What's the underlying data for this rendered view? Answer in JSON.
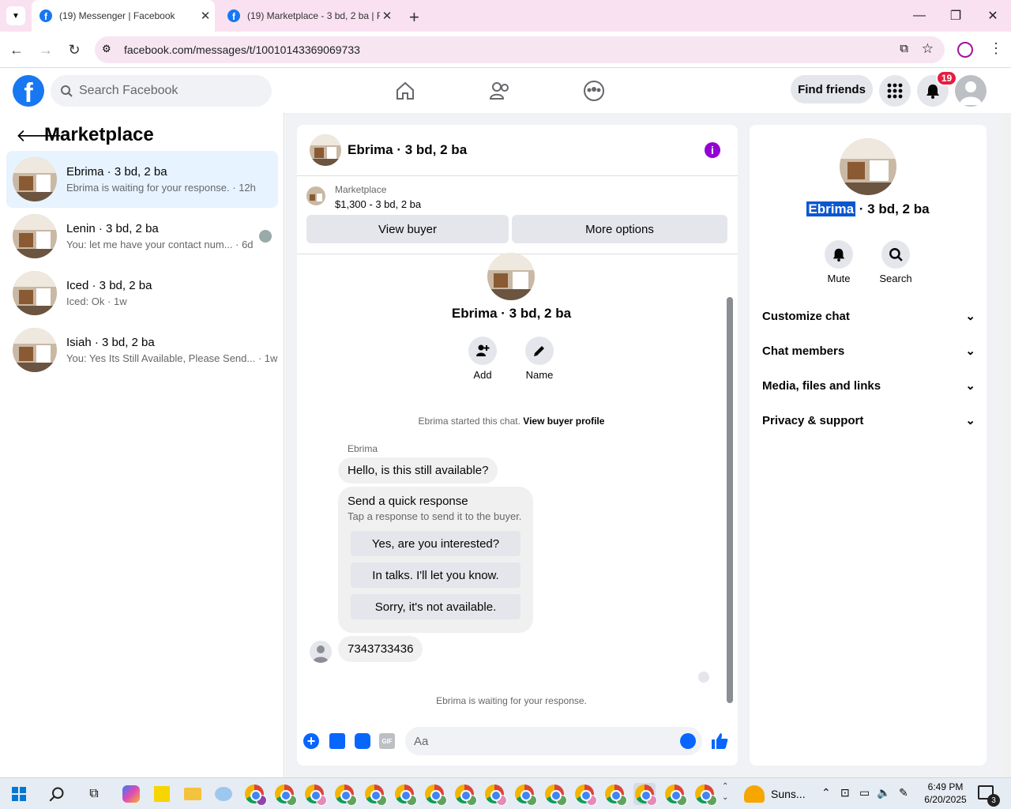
{
  "browser": {
    "tabs": [
      {
        "title": "(19) Messenger | Facebook"
      },
      {
        "title": "(19) Marketplace - 3 bd, 2 ba | Facebook"
      }
    ],
    "url": "facebook.com/messages/t/10010143369069733"
  },
  "fb": {
    "search_placeholder": "Search Facebook",
    "find_friends": "Find friends",
    "notif_count": "19"
  },
  "sidebar": {
    "title": "Marketplace",
    "conversations": [
      {
        "name": "Ebrima · 3 bd, 2 ba",
        "preview": "Ebrima is waiting for your response. · 12h",
        "selected": true
      },
      {
        "name": "Lenin · 3 bd, 2 ba",
        "preview": "You: let me have your contact num... · 6d"
      },
      {
        "name": "Iced · 3 bd, 2 ba",
        "preview": "Iced: Ok · 1w"
      },
      {
        "name": "Isiah · 3 bd, 2 ba",
        "preview": "You: Yes Its Still Available, Please Send... · 1w"
      }
    ]
  },
  "chat": {
    "header_title": "Ebrima · 3 bd, 2 ba",
    "marketplace_label": "Marketplace",
    "listing": "$1,300 - 3 bd, 2 ba",
    "view_buyer": "View buyer",
    "more_options": "More options",
    "profile_name": "Ebrima · 3 bd, 2 ba",
    "add_label": "Add",
    "name_label": "Name",
    "started_text": "Ebrima started this chat.",
    "view_buyer_profile": "View buyer profile",
    "sender": "Ebrima",
    "message1": "Hello, is this still available?",
    "quick_title": "Send a quick response",
    "quick_sub": "Tap a response to send it to the buyer.",
    "quick_responses": [
      "Yes, are you interested?",
      "In talks. I'll let you know.",
      "Sorry, it's not available."
    ],
    "message2": "7343733436",
    "waiting": "Ebrima is waiting for your response.",
    "composer_placeholder": "Aa"
  },
  "details": {
    "name_highlight": "Ebrima",
    "name_rest": " · 3 bd, 2 ba",
    "mute": "Mute",
    "search": "Search",
    "sections": [
      "Customize chat",
      "Chat members",
      "Media, files and links",
      "Privacy & support"
    ]
  },
  "taskbar": {
    "weather": "Suns...",
    "time": "6:49 PM",
    "date": "6/20/2025",
    "notif": "3"
  },
  "colors": {
    "brand": "#1877f2",
    "selected": "#e7f3ff",
    "info": "#9400d3",
    "badge": "#e41e3f"
  }
}
